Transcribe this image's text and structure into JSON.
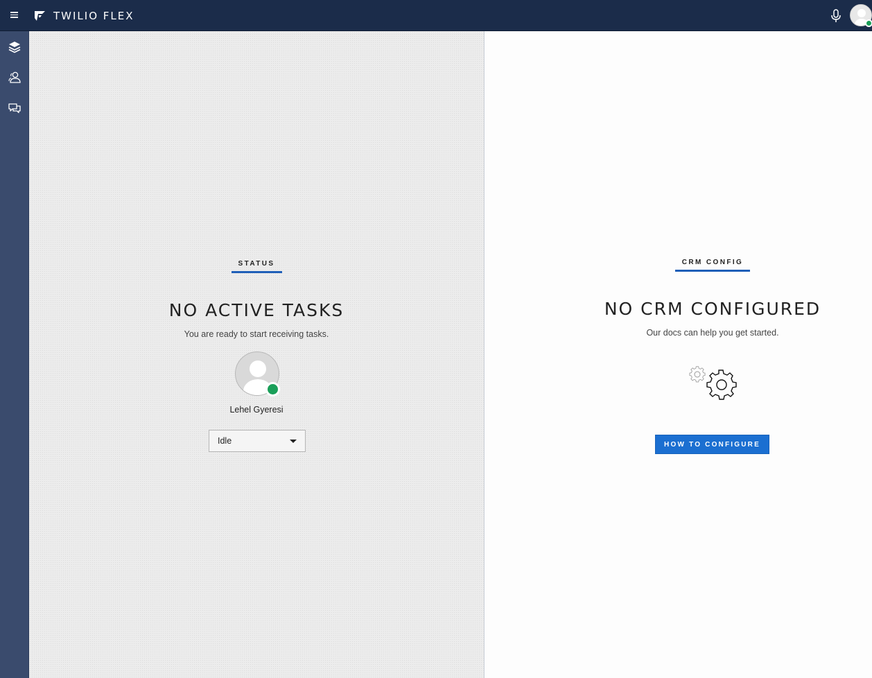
{
  "header": {
    "brand": "TWILIO FLEX",
    "menu_icon": "hamburger-menu-icon",
    "logo_icon": "twilio-flex-logo",
    "mic_icon": "microphone-icon",
    "user_status_color": "#1a9f59"
  },
  "sidenav": {
    "items": [
      {
        "icon": "layers-icon",
        "name": "agent-desktop"
      },
      {
        "icon": "teams-icon",
        "name": "teams"
      },
      {
        "icon": "chat-bubbles-icon",
        "name": "conversations"
      }
    ]
  },
  "status_panel": {
    "label": "STATUS",
    "title": "NO ACTIVE TASKS",
    "subtitle": "You are ready to start receiving tasks.",
    "worker_name": "Lehel Gyeresi",
    "activity": "Idle"
  },
  "crm_panel": {
    "label": "CRM CONFIG",
    "title": "NO CRM CONFIGURED",
    "subtitle": "Our docs can help you get started.",
    "button_label": "HOW TO CONFIGURE"
  },
  "colors": {
    "topbar": "#1b2c4a",
    "sidenav": "#3a4b6d",
    "accent": "#1f5fb8",
    "button": "#1b6fd1",
    "available": "#1a9f59"
  }
}
